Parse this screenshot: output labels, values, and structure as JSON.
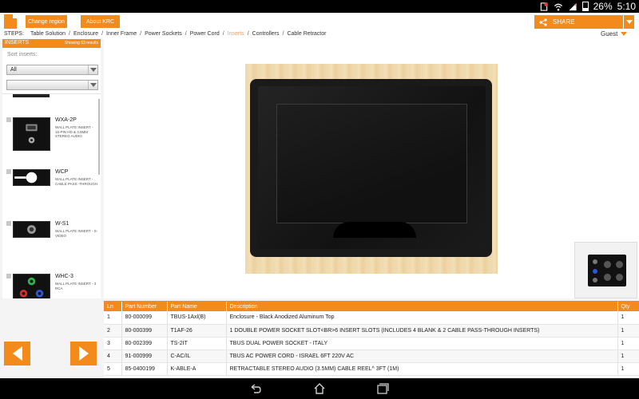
{
  "status_bar": {
    "battery_percent": "26%",
    "time": "5:10",
    "icons": [
      "notification-icon",
      "wifi-icon",
      "signal-icon",
      "battery-icon"
    ]
  },
  "topbar": {
    "change_region_label": "Change region",
    "about_label": "About KRC",
    "share_label": "SHARE"
  },
  "steps": {
    "label": "STEPS:",
    "items": [
      {
        "label": "Table Solution",
        "active": false
      },
      {
        "label": "Enclosure",
        "active": false
      },
      {
        "label": "Inner Frame",
        "active": false
      },
      {
        "label": "Power Sockets",
        "active": false
      },
      {
        "label": "Power Cord",
        "active": false
      },
      {
        "label": "Inserts",
        "active": true
      },
      {
        "label": "Controllers",
        "active": false
      },
      {
        "label": "Cable Retractor",
        "active": false
      }
    ],
    "user_label": "Guest"
  },
  "inserts_panel": {
    "title": "INSERTS",
    "count_text": "Showing 63 results",
    "sort_label": "Sort inserts:",
    "sort_value": "All",
    "filter_value": "",
    "items": [
      {
        "code": "WXA-2P",
        "desc": "WALL PLATE INSERT - 15-PIN HD & 3.5MM STEREO AUDIO"
      },
      {
        "code": "WCP",
        "desc": "WALL PLATE INSERT - CABLE PASS -THROUGH"
      },
      {
        "code": "W-S1",
        "desc": "WALL PLATE INSERT - S-VIDEO"
      },
      {
        "code": "WHC-3",
        "desc": "WALL PLATE INSERT - 3 RCA"
      }
    ]
  },
  "table": {
    "headers": [
      "Ln",
      "Part Number",
      "Part Name",
      "Description",
      "Qty"
    ],
    "rows": [
      [
        "1",
        "80-000099",
        "TBUS-1Axl(B)",
        "Enclosure - Black Anodized Aluminum Top",
        "1"
      ],
      [
        "2",
        "80-000399",
        "T1AF-26",
        "1 DOUBLE POWER SOCKET SLOT<BR>6 INSERT SLOTS (INCLUDES 4 BLANK & 2 CABLE PASS-THROUGH INSERTS)",
        "1"
      ],
      [
        "3",
        "80-002399",
        "TS-2IT",
        "TBUS DUAL POWER SOCKET - ITALY",
        "1"
      ],
      [
        "4",
        "91-000999",
        "C-AC/IL",
        "TBUS AC POWER CORD - ISRAEL 6FT 220V AC",
        "1"
      ],
      [
        "5",
        "85-0400199",
        "K-ABLE-A",
        "RETRACTABLE STEREO AUDIO (3.5MM) CABLE REEL^ 3FT (1M)",
        "1"
      ]
    ]
  },
  "colors": {
    "accent": "#f28a1c",
    "active_step": "#f0a060"
  }
}
